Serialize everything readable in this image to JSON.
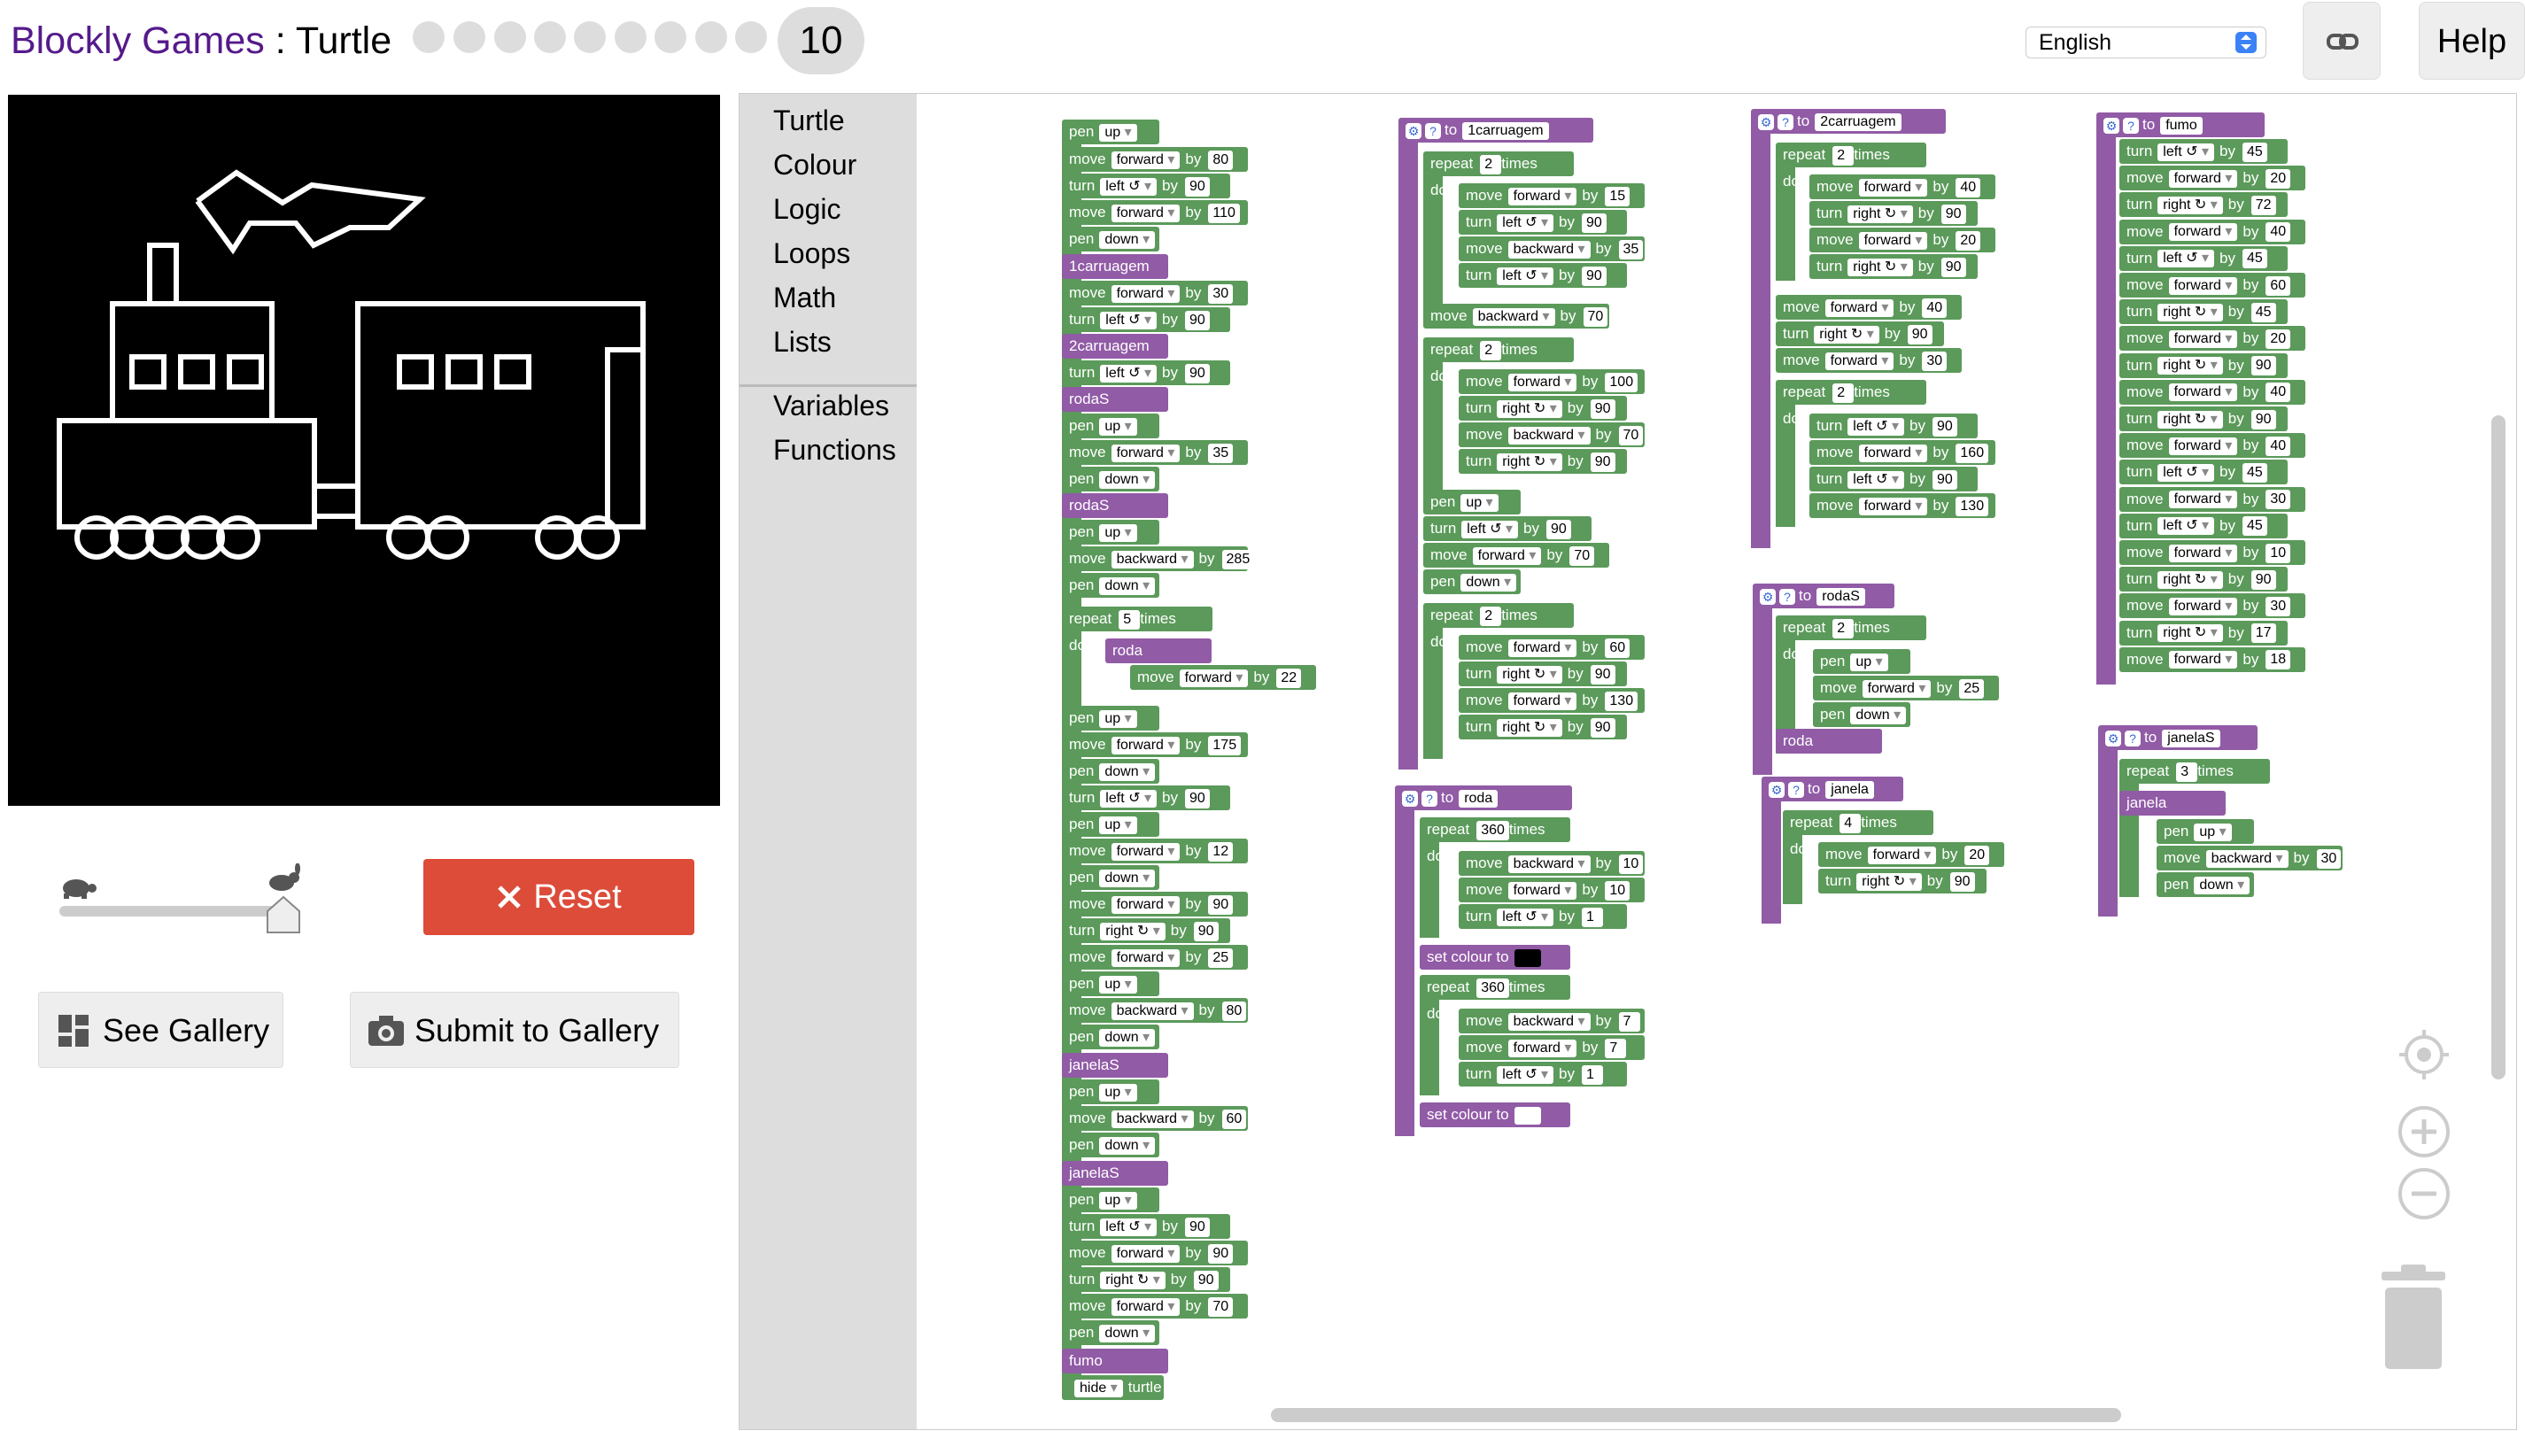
{
  "header": {
    "brand": "Blockly Games",
    "separator": " : ",
    "title": "Turtle",
    "level": "10",
    "language": "English",
    "help_label": "Help"
  },
  "colors": {
    "brand": "#551a8b",
    "reset": "#dd4b39",
    "procedure": "#915ba6",
    "turtle": "#5b9a5a",
    "canvas": "#000000"
  },
  "toolbox": {
    "categories": [
      "Turtle",
      "Colour",
      "Logic",
      "Loops",
      "Math",
      "Lists",
      "Variables",
      "Functions"
    ]
  },
  "controls": {
    "reset_label": "Reset",
    "gallery_label": "See Gallery",
    "submit_label": "Submit to Gallery"
  },
  "icons": {
    "link": "link-icon",
    "help": "help",
    "reset": "close-icon",
    "gallery": "grid-icon",
    "submit": "camera-icon",
    "slow": "turtle-icon",
    "fast": "rabbit-icon",
    "center": "target-icon",
    "zoom_in": "zoom-in-icon",
    "zoom_out": "zoom-out-icon",
    "trash": "trash-icon"
  },
  "kw": {
    "pen": "pen",
    "up": "up",
    "down": "down",
    "move": "move",
    "forward": "forward",
    "backward": "backward",
    "by": "by",
    "turn": "turn",
    "left": "left ↺",
    "right": "right ↻",
    "repeat": "repeat",
    "times": "times",
    "do": "do",
    "to": "to",
    "set_colour": "set colour to",
    "hide": "hide",
    "turtle": "turtle"
  },
  "calls": {
    "c1": "1carruagem",
    "c2": "2carruagem",
    "rodaS": "rodaS",
    "roda": "roda",
    "janelaS": "janelaS",
    "janela": "janela",
    "fumo": "fumo"
  },
  "values": {
    "m1": [
      "80",
      "90",
      "110",
      "30",
      "90",
      "90",
      "35",
      "285",
      "5",
      "22",
      "175",
      "90",
      "12",
      "90",
      "90",
      "25",
      "80",
      "60",
      "90",
      "90",
      "90",
      "70"
    ],
    "c1": [
      "2",
      "15",
      "90",
      "35",
      "90",
      "70",
      "2",
      "100",
      "90",
      "70",
      "90",
      "90",
      "70",
      "2",
      "60",
      "90",
      "130",
      "90"
    ],
    "c2": [
      "2",
      "40",
      "90",
      "20",
      "90",
      "40",
      "90",
      "30",
      "2",
      "90",
      "160",
      "90",
      "130"
    ],
    "fumo": [
      "45",
      "20",
      "72",
      "40",
      "45",
      "60",
      "45",
      "20",
      "90",
      "40",
      "90",
      "40",
      "45",
      "30",
      "45",
      "10",
      "90",
      "30",
      "17",
      "18"
    ],
    "roda": [
      "360",
      "10",
      "10",
      "1",
      "360",
      "7",
      "7",
      "1"
    ],
    "rodaS": [
      "2",
      "25"
    ],
    "janela": [
      "4",
      "20",
      "90"
    ],
    "janelaS": [
      "3",
      "30"
    ]
  }
}
